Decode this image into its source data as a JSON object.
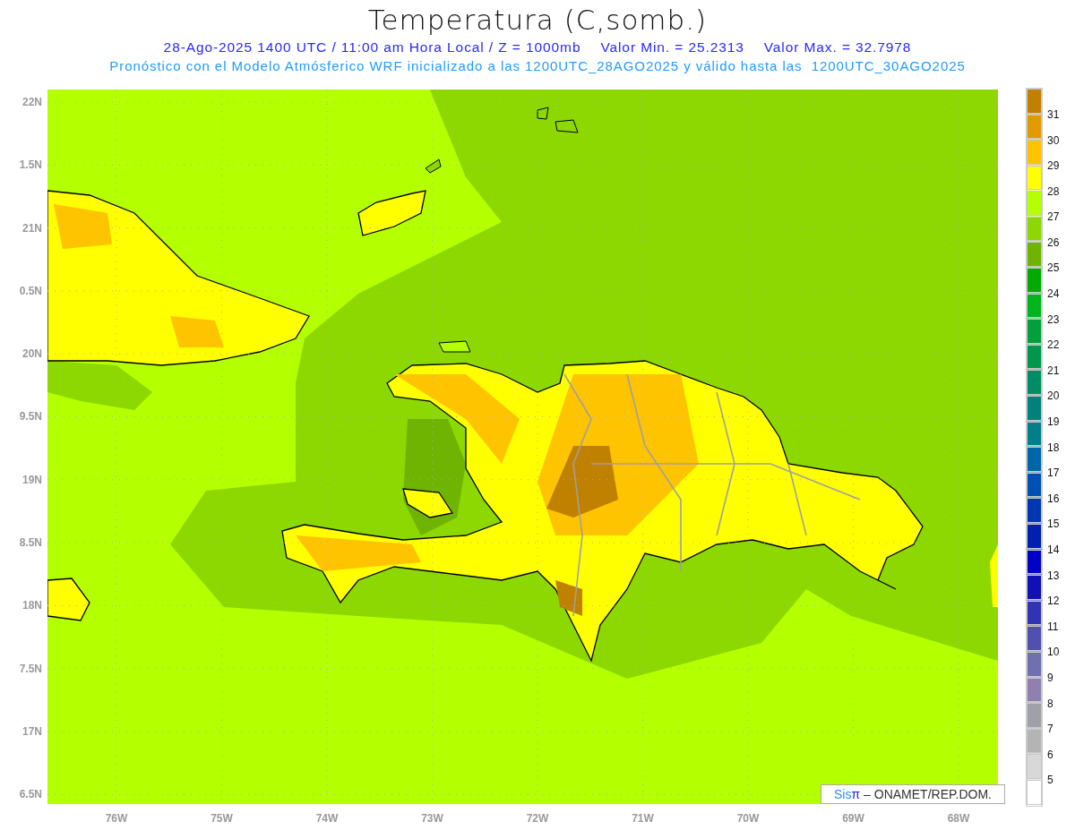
{
  "title": "Temperatura (C,somb.)",
  "subtitle": {
    "main": "28-Ago-2025 1400 UTC / 11:00 am Hora Local / Z = 1000mb",
    "min": "Valor Min. = 25.2313",
    "max": "Valor Max. = 32.7978"
  },
  "note": "Pronóstico con el Modelo Atmósferico WRF inicializado a las 1200UTC_28AGO2025 y válido hasta las  1200UTC_30AGO2025",
  "map": {
    "y_ticks": [
      "22N",
      "1.5N",
      "21N",
      "0.5N",
      "20N",
      "9.5N",
      "19N",
      "8.5N",
      "18N",
      "7.5N",
      "17N",
      "6.5N"
    ],
    "x_ticks": [
      "76W",
      "75W",
      "74W",
      "73W",
      "72W",
      "71W",
      "70W",
      "69W",
      "68W"
    ],
    "credit": {
      "logo": "Sis",
      "symbol": "π",
      "text": "– ONAMET/REP.DOM."
    }
  },
  "legend": {
    "levels": [
      {
        "color": "#c08000"
      },
      {
        "color": "#e09a00"
      },
      {
        "color": "#ffc400"
      },
      {
        "color": "#ffff00"
      },
      {
        "color": "#b4ff00"
      },
      {
        "color": "#8cd800"
      },
      {
        "color": "#6eb400"
      },
      {
        "color": "#00aa00"
      },
      {
        "color": "#00b41e"
      },
      {
        "color": "#00a03c"
      },
      {
        "color": "#00964b"
      },
      {
        "color": "#008c64"
      },
      {
        "color": "#00827a"
      },
      {
        "color": "#007e8a"
      },
      {
        "color": "#0066a8"
      },
      {
        "color": "#0050b4"
      },
      {
        "color": "#0038b4"
      },
      {
        "color": "#0020b0"
      },
      {
        "color": "#0000c8"
      },
      {
        "color": "#1010b4"
      },
      {
        "color": "#3232b4"
      },
      {
        "color": "#5050b0"
      },
      {
        "color": "#7070b0"
      },
      {
        "color": "#9080b0"
      },
      {
        "color": "#a0a0a8"
      },
      {
        "color": "#b4b4b4"
      },
      {
        "color": "#d8d8d8"
      },
      {
        "color": "#ffffff"
      }
    ],
    "labels": [
      "31",
      "30",
      "29",
      "28",
      "27",
      "26",
      "25",
      "24",
      "23",
      "22",
      "21",
      "20",
      "19",
      "18",
      "17",
      "16",
      "15",
      "14",
      "13",
      "12",
      "11",
      "10",
      "9",
      "8",
      "7",
      "6",
      "5"
    ]
  }
}
